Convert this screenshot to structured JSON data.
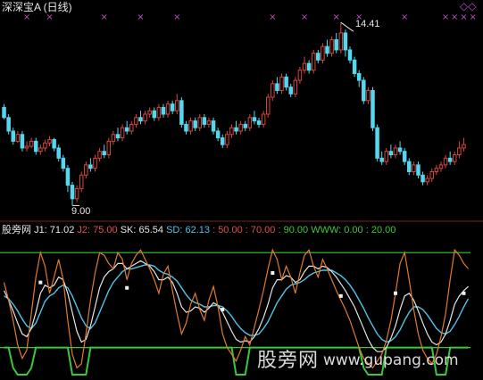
{
  "header": {
    "title": "深深宝A (日线)"
  },
  "price_chart": {
    "high_label": "14.41",
    "low_label": "9.00",
    "up_color": "#d8453c",
    "down_color": "#54d8f0",
    "marker_color": "#c050c0",
    "marker_symbol": "×"
  },
  "indicator": {
    "legend": [
      {
        "key": "name",
        "text": "股旁网",
        "color": "#e6e6e6"
      },
      {
        "key": "j1",
        "text": "J1: 71.02",
        "color": "#e6e6e6"
      },
      {
        "key": "j2",
        "text": "J2: 75.00",
        "color": "#e0504a"
      },
      {
        "key": "sk",
        "text": "SK: 65.54",
        "color": "#e6e6e6"
      },
      {
        "key": "sd",
        "text": "SD: 62.13",
        "color": "#4fc3e8"
      },
      {
        "key": "l50",
        "text": ": 50.00",
        "color": "#e0504a"
      },
      {
        "key": "l70",
        "text": ": 70.00",
        "color": "#e0504a"
      },
      {
        "key": "l90",
        "text": ": 90.00",
        "color": "#3cc83c"
      },
      {
        "key": "www",
        "text": "WWW: 0.00",
        "color": "#3cc83c"
      },
      {
        "key": "l20",
        "text": ": 20.00",
        "color": "#3cc83c"
      }
    ],
    "sk_color": "#e6e6e6",
    "sd_color": "#4fc3e8",
    "j_color": "#e07a30",
    "level_color": "#3cc83c"
  },
  "watermark": {
    "name": "股旁网",
    "url": "www.gupang.com"
  },
  "corner_icon": "◇◇",
  "chart_data": {
    "type": "candlestick",
    "title": "深深宝A (日线)",
    "price_range": [
      8.8,
      14.6
    ],
    "annotations": [
      {
        "text": "14.41",
        "value": 14.41
      },
      {
        "text": "9.00",
        "value": 9.0
      }
    ],
    "candles": [
      [
        11.9,
        11.6,
        12.0,
        11.55
      ],
      [
        11.6,
        11.2,
        11.7,
        11.1
      ],
      [
        11.2,
        10.9,
        11.3,
        10.8
      ],
      [
        10.9,
        11.1,
        11.2,
        10.85
      ],
      [
        11.1,
        10.7,
        11.2,
        10.6
      ],
      [
        10.7,
        10.75,
        10.9,
        10.6
      ],
      [
        10.75,
        10.9,
        11.0,
        10.7
      ],
      [
        10.9,
        10.6,
        11.0,
        10.5
      ],
      [
        10.6,
        10.7,
        10.8,
        10.5
      ],
      [
        10.7,
        10.85,
        10.95,
        10.6
      ],
      [
        10.85,
        10.95,
        11.05,
        10.75
      ],
      [
        10.95,
        10.7,
        11.0,
        10.6
      ],
      [
        10.7,
        10.4,
        10.8,
        10.3
      ],
      [
        10.4,
        10.1,
        10.5,
        10.0
      ],
      [
        10.1,
        9.6,
        10.2,
        9.4
      ],
      [
        9.6,
        9.2,
        9.7,
        9.0
      ],
      [
        9.2,
        9.5,
        9.6,
        9.1
      ],
      [
        9.5,
        9.9,
        10.0,
        9.4
      ],
      [
        9.9,
        10.2,
        10.3,
        9.8
      ],
      [
        10.2,
        10.1,
        10.4,
        10.0
      ],
      [
        10.1,
        10.4,
        10.5,
        10.0
      ],
      [
        10.4,
        10.6,
        10.7,
        10.3
      ],
      [
        10.6,
        10.5,
        10.8,
        10.4
      ],
      [
        10.5,
        10.9,
        11.0,
        10.4
      ],
      [
        10.9,
        11.1,
        11.2,
        10.8
      ],
      [
        11.1,
        11.0,
        11.3,
        10.9
      ],
      [
        11.0,
        11.3,
        11.4,
        10.9
      ],
      [
        11.3,
        11.2,
        11.5,
        11.1
      ],
      [
        11.2,
        11.4,
        11.5,
        11.1
      ],
      [
        11.4,
        11.6,
        11.7,
        11.3
      ],
      [
        11.6,
        11.5,
        11.8,
        11.4
      ],
      [
        11.5,
        11.7,
        11.8,
        11.4
      ],
      [
        11.7,
        11.8,
        11.9,
        11.6
      ],
      [
        11.8,
        11.6,
        11.9,
        11.5
      ],
      [
        11.6,
        11.9,
        12.0,
        11.5
      ],
      [
        11.9,
        11.7,
        12.0,
        11.6
      ],
      [
        11.7,
        12.0,
        12.1,
        11.6
      ],
      [
        12.0,
        11.8,
        12.1,
        11.7
      ],
      [
        11.8,
        12.1,
        12.3,
        11.7
      ],
      [
        12.1,
        11.4,
        12.2,
        11.3
      ],
      [
        11.4,
        11.2,
        11.5,
        11.1
      ],
      [
        11.2,
        11.5,
        11.6,
        11.1
      ],
      [
        11.5,
        11.3,
        11.6,
        11.2
      ],
      [
        11.3,
        11.6,
        11.7,
        11.2
      ],
      [
        11.6,
        11.4,
        11.7,
        11.3
      ],
      [
        11.4,
        11.5,
        11.6,
        11.3
      ],
      [
        11.5,
        11.2,
        11.6,
        11.1
      ],
      [
        11.2,
        11.0,
        11.3,
        10.9
      ],
      [
        11.0,
        10.8,
        11.1,
        10.7
      ],
      [
        10.8,
        11.1,
        11.2,
        10.7
      ],
      [
        11.1,
        11.3,
        11.4,
        11.0
      ],
      [
        11.3,
        11.2,
        11.5,
        11.1
      ],
      [
        11.2,
        11.4,
        11.5,
        11.1
      ],
      [
        11.4,
        11.3,
        11.5,
        11.2
      ],
      [
        11.3,
        11.6,
        11.7,
        11.2
      ],
      [
        11.6,
        11.5,
        11.8,
        11.4
      ],
      [
        11.5,
        11.4,
        11.6,
        11.3
      ],
      [
        11.4,
        11.7,
        11.8,
        11.3
      ],
      [
        11.7,
        12.2,
        12.3,
        11.6
      ],
      [
        12.2,
        12.6,
        12.7,
        12.1
      ],
      [
        12.6,
        12.4,
        12.8,
        12.3
      ],
      [
        12.4,
        12.8,
        12.9,
        12.3
      ],
      [
        12.8,
        12.5,
        12.9,
        12.4
      ],
      [
        12.5,
        12.3,
        12.6,
        12.2
      ],
      [
        12.3,
        12.7,
        12.8,
        12.2
      ],
      [
        12.7,
        13.0,
        13.1,
        12.6
      ],
      [
        13.0,
        13.2,
        13.4,
        12.9
      ],
      [
        13.2,
        13.0,
        13.3,
        12.9
      ],
      [
        13.0,
        13.5,
        13.6,
        12.9
      ],
      [
        13.5,
        13.3,
        13.6,
        13.2
      ],
      [
        13.3,
        13.7,
        13.8,
        13.2
      ],
      [
        13.7,
        13.5,
        13.9,
        13.4
      ],
      [
        13.5,
        13.9,
        14.0,
        13.4
      ],
      [
        13.9,
        13.6,
        14.1,
        13.5
      ],
      [
        13.6,
        14.1,
        14.41,
        13.5
      ],
      [
        14.1,
        13.6,
        14.2,
        13.4
      ],
      [
        13.6,
        13.3,
        13.7,
        13.2
      ],
      [
        13.3,
        12.9,
        13.4,
        12.8
      ],
      [
        12.9,
        12.7,
        13.0,
        12.5
      ],
      [
        12.7,
        12.1,
        12.8,
        12.0
      ],
      [
        12.1,
        12.4,
        12.5,
        12.0
      ],
      [
        12.4,
        11.3,
        12.5,
        11.2
      ],
      [
        11.3,
        10.4,
        11.4,
        10.3
      ],
      [
        10.4,
        10.3,
        10.6,
        10.2
      ],
      [
        10.3,
        10.6,
        10.7,
        10.2
      ],
      [
        10.6,
        10.5,
        10.8,
        10.4
      ],
      [
        10.5,
        10.7,
        10.8,
        10.4
      ],
      [
        10.7,
        10.6,
        10.9,
        10.5
      ],
      [
        10.6,
        10.3,
        10.7,
        10.2
      ],
      [
        10.3,
        10.0,
        10.4,
        9.9
      ],
      [
        10.0,
        10.2,
        10.3,
        9.9
      ],
      [
        10.2,
        9.9,
        10.3,
        9.8
      ],
      [
        9.9,
        9.7,
        10.0,
        9.6
      ],
      [
        9.7,
        9.8,
        9.9,
        9.6
      ],
      [
        9.8,
        10.0,
        10.1,
        9.7
      ],
      [
        10.0,
        10.1,
        10.2,
        9.9
      ],
      [
        10.1,
        10.2,
        10.3,
        10.0
      ],
      [
        10.2,
        10.4,
        10.5,
        10.1
      ],
      [
        10.4,
        10.3,
        10.6,
        10.2
      ],
      [
        10.3,
        10.5,
        10.6,
        10.2
      ],
      [
        10.5,
        10.7,
        10.9,
        10.4
      ],
      [
        10.7,
        10.8,
        11.0,
        10.6
      ]
    ],
    "marker_positions": [
      5,
      10,
      22,
      30,
      38,
      59,
      66,
      73,
      78,
      88,
      97,
      99,
      101,
      103
    ],
    "indicator": {
      "range": [
        0,
        100
      ],
      "levels": [
        90,
        20
      ],
      "series": {
        "J": [
          68,
          55,
          40,
          22,
          12,
          18,
          45,
          72,
          90,
          80,
          60,
          72,
          85,
          70,
          40,
          15,
          5,
          8,
          30,
          55,
          75,
          90,
          88,
          82,
          78,
          90,
          85,
          70,
          82,
          88,
          92,
          85,
          78,
          70,
          60,
          74,
          80,
          62,
          45,
          30,
          38,
          52,
          60,
          48,
          40,
          55,
          65,
          50,
          30,
          20,
          15,
          10,
          18,
          28,
          22,
          35,
          48,
          62,
          78,
          92,
          85,
          70,
          80,
          72,
          60,
          75,
          88,
          92,
          80,
          72,
          85,
          78,
          70,
          62,
          55,
          48,
          40,
          30,
          20,
          12,
          8,
          5,
          10,
          15,
          25,
          40,
          60,
          82,
          90,
          70,
          48,
          30,
          18,
          12,
          8,
          15,
          28,
          45,
          70,
          92,
          88,
          82,
          78
        ],
        "SK": [
          62,
          55,
          47,
          38,
          30,
          28,
          34,
          46,
          60,
          66,
          64,
          66,
          72,
          70,
          60,
          46,
          32,
          24,
          26,
          36,
          50,
          64,
          72,
          76,
          78,
          82,
          82,
          78,
          80,
          82,
          84,
          82,
          80,
          76,
          70,
          70,
          72,
          68,
          60,
          50,
          46,
          47,
          50,
          49,
          46,
          49,
          53,
          51,
          46,
          39,
          32,
          26,
          24,
          25,
          24,
          28,
          34,
          42,
          52,
          64,
          70,
          70,
          73,
          72,
          68,
          70,
          76,
          80,
          80,
          78,
          80,
          79,
          76,
          72,
          67,
          62,
          56,
          50,
          42,
          34,
          26,
          20,
          17,
          17,
          20,
          27,
          36,
          48,
          58,
          60,
          55,
          47,
          38,
          30,
          24,
          22,
          24,
          30,
          40,
          52,
          58,
          62,
          65
        ],
        "SD": [
          58,
          56,
          52,
          47,
          41,
          36,
          34,
          38,
          46,
          54,
          58,
          60,
          64,
          66,
          64,
          58,
          50,
          42,
          36,
          34,
          38,
          46,
          54,
          62,
          68,
          72,
          76,
          78,
          78,
          79,
          80,
          81,
          81,
          80,
          77,
          75,
          74,
          72,
          69,
          64,
          59,
          55,
          53,
          52,
          50,
          50,
          51,
          51,
          50,
          47,
          43,
          38,
          34,
          31,
          29,
          29,
          30,
          34,
          39,
          46,
          53,
          58,
          63,
          66,
          67,
          68,
          70,
          73,
          75,
          76,
          77,
          77,
          77,
          75,
          73,
          70,
          66,
          61,
          55,
          49,
          42,
          36,
          30,
          26,
          24,
          25,
          28,
          33,
          40,
          46,
          50,
          50,
          48,
          44,
          39,
          34,
          31,
          30,
          32,
          37,
          43,
          50,
          56
        ],
        "WWW": [
          20,
          20,
          5,
          0,
          0,
          0,
          5,
          20,
          20,
          20,
          20,
          20,
          20,
          20,
          20,
          0,
          0,
          0,
          0,
          20,
          20,
          20,
          20,
          20,
          20,
          20,
          20,
          20,
          20,
          20,
          20,
          20,
          20,
          20,
          20,
          20,
          20,
          20,
          20,
          20,
          20,
          20,
          20,
          20,
          20,
          20,
          20,
          20,
          20,
          20,
          20,
          0,
          0,
          0,
          20,
          20,
          20,
          20,
          20,
          20,
          20,
          20,
          20,
          20,
          20,
          20,
          20,
          20,
          20,
          20,
          20,
          20,
          20,
          20,
          20,
          20,
          20,
          20,
          20,
          5,
          0,
          0,
          0,
          0,
          20,
          20,
          20,
          20,
          20,
          20,
          20,
          20,
          20,
          20,
          20,
          0,
          0,
          0,
          20,
          20,
          20,
          20,
          20
        ]
      },
      "markers": [
        {
          "i": 8,
          "v": 68
        },
        {
          "i": 27,
          "v": 64
        },
        {
          "i": 48,
          "v": 48
        },
        {
          "i": 59,
          "v": 75
        },
        {
          "i": 74,
          "v": 58
        },
        {
          "i": 86,
          "v": 60
        },
        {
          "i": 101,
          "v": 60
        }
      ]
    }
  }
}
